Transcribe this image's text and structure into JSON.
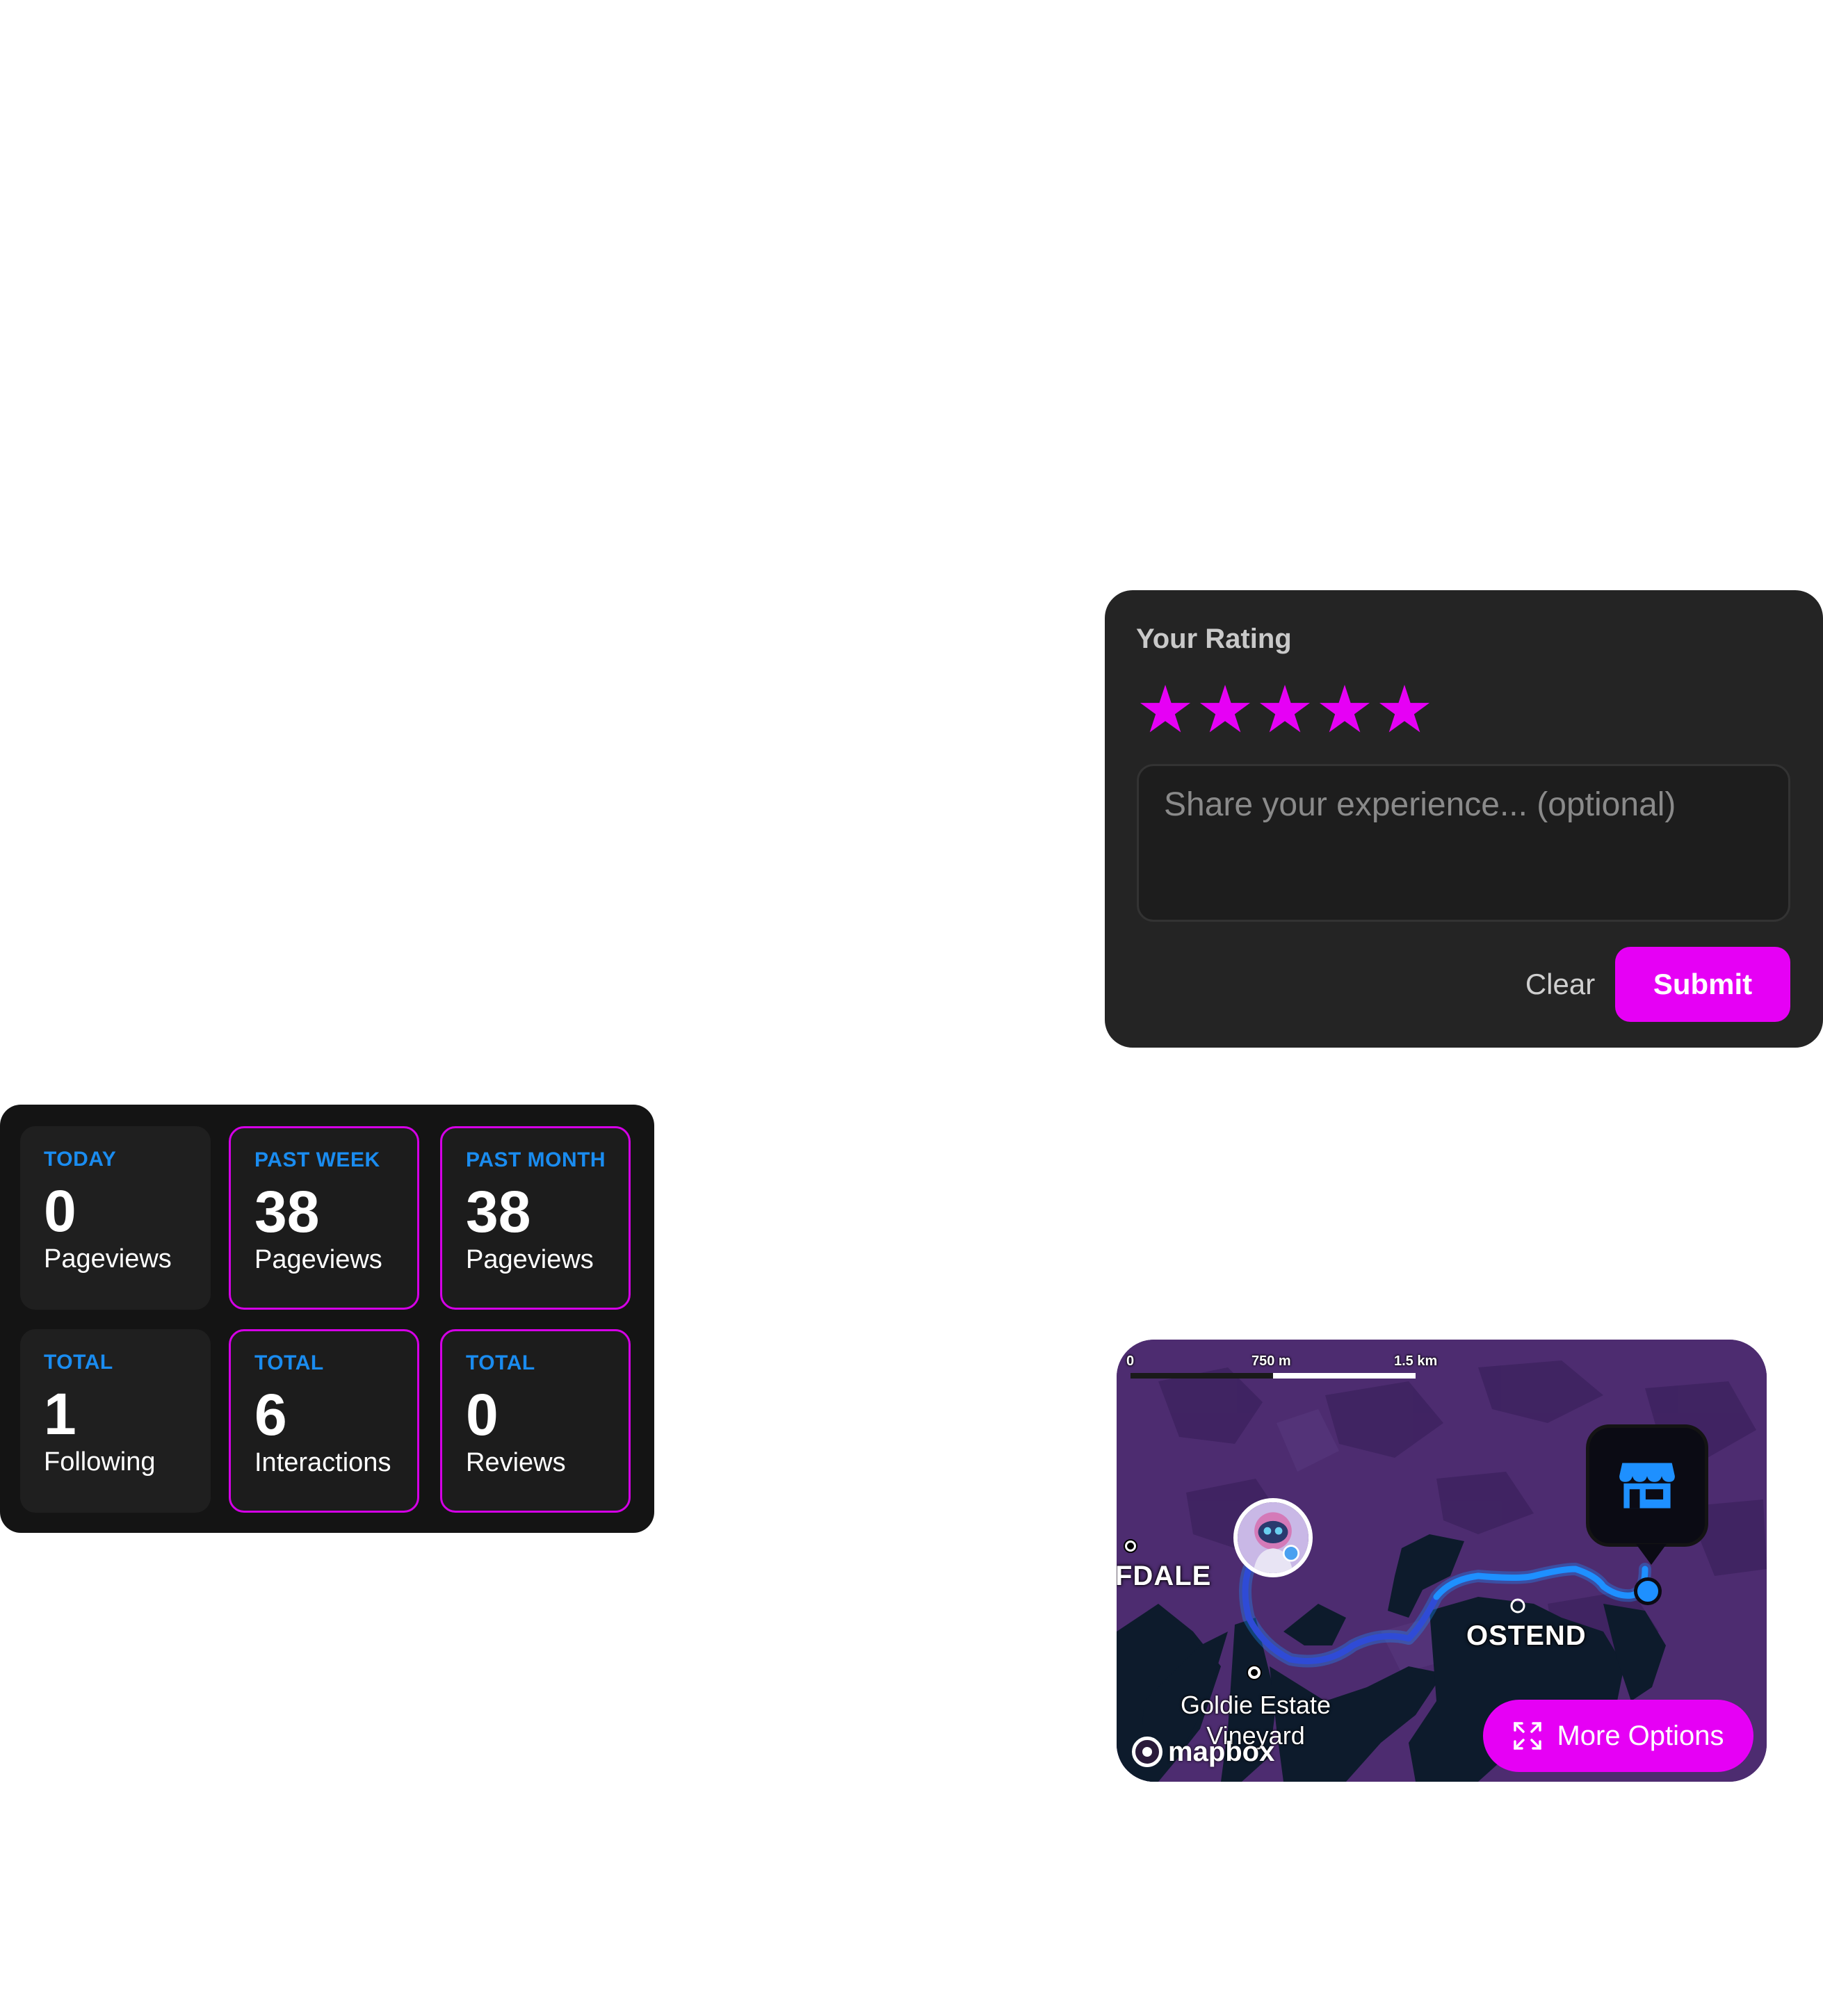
{
  "colors": {
    "accent": "#e600f5",
    "label_blue": "#1a8cf0",
    "card_bg": "#242424",
    "map_bg": "#4a2a6c",
    "route_blue": "#1e90ff"
  },
  "rating": {
    "title": "Your Rating",
    "stars_filled": 5,
    "stars_total": 5,
    "input_placeholder": "Share your experience... (optional)",
    "input_value": "",
    "clear_label": "Clear",
    "submit_label": "Submit"
  },
  "stats": {
    "tiles": [
      {
        "label": "TODAY",
        "value": "0",
        "caption": "Pageviews",
        "outlined": false
      },
      {
        "label": "PAST WEEK",
        "value": "38",
        "caption": "Pageviews",
        "outlined": true
      },
      {
        "label": "PAST MONTH",
        "value": "38",
        "caption": "Pageviews",
        "outlined": true
      },
      {
        "label": "TOTAL",
        "value": "1",
        "caption": "Following",
        "outlined": false
      },
      {
        "label": "TOTAL",
        "value": "6",
        "caption": "Interactions",
        "outlined": true
      },
      {
        "label": "TOTAL",
        "value": "0",
        "caption": "Reviews",
        "outlined": true
      }
    ]
  },
  "map": {
    "scale": {
      "zero": "0",
      "mid": "750 m",
      "max": "1.5 km"
    },
    "places": {
      "left_town": "FDALE",
      "town": "OSTEND",
      "poi_line1": "Goldie Estate",
      "poi_line2": "Vineyard"
    },
    "attribution": "mapbox",
    "more_options_label": "More Options",
    "icons": {
      "more_options": "expand-icon",
      "pin": "storefront-icon",
      "avatar": "astronaut-avatar"
    }
  }
}
